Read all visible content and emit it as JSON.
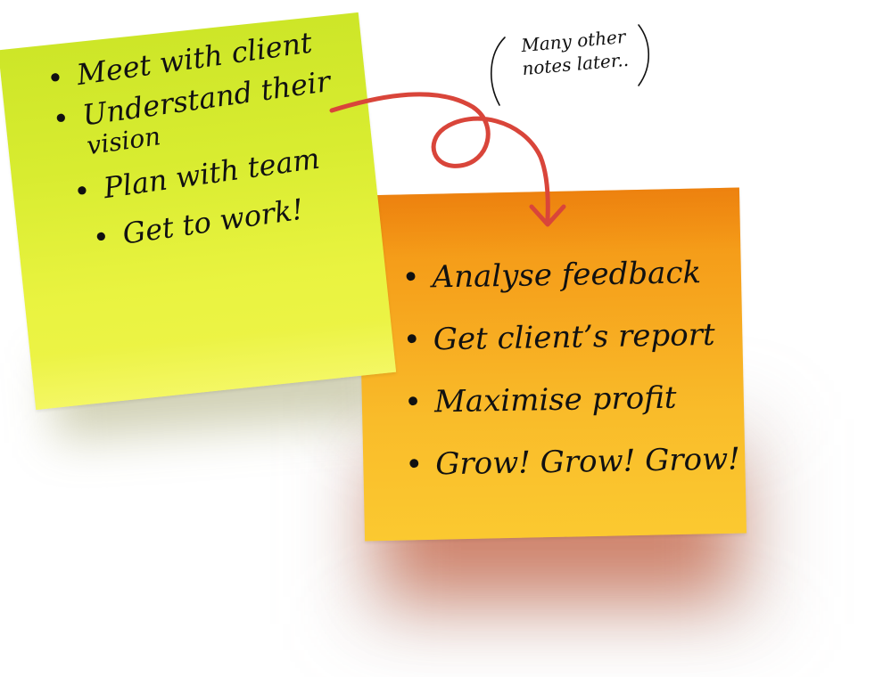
{
  "notes": {
    "green": {
      "color": "#d8ec30",
      "bullet": "•",
      "items": [
        "Meet with client",
        "Understand their",
        "vision",
        "Plan with team",
        "Get to work!"
      ]
    },
    "orange": {
      "color": "#f6a41d",
      "bullet": "•",
      "items": [
        "Analyse feedback",
        "Get client’s report",
        "Maximise profit",
        "Grow! Grow! Grow!"
      ]
    }
  },
  "annotation": {
    "lines": [
      "Many other",
      "notes later.."
    ]
  },
  "arrow": {
    "color": "#d9453a",
    "icon": "curved-loop-arrow-icon"
  }
}
